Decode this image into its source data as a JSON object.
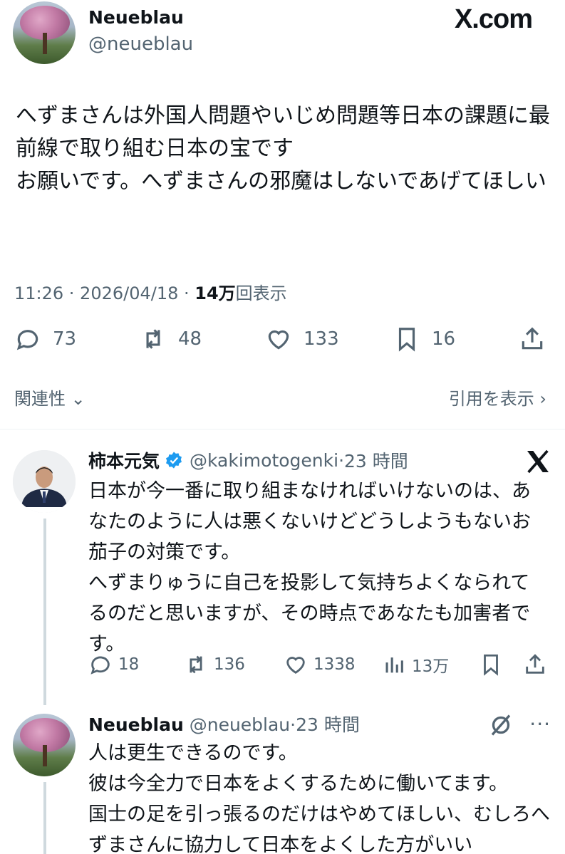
{
  "site_logo": "X.com",
  "main_post": {
    "author_name": "Neueblau",
    "author_handle": "@neueblau",
    "text": "へずまさんは外国人問題やいじめ問題等日本の課題に最前線で取り組む日本の宝です\nお願いです。へずまさんの邪魔はしないであげてほしい",
    "timestamp": "11:26 · 2026/04/18 · ",
    "views_count": "14万",
    "views_label": "回表示",
    "replies": "73",
    "reposts": "48",
    "likes": "133",
    "bookmarks": "16"
  },
  "related_label": "関連性",
  "quotes_label": "引用を表示",
  "reply_1": {
    "author_name": "柿本元気",
    "author_handle": "@kakimotogenki",
    "time": "23 時間",
    "text": "日本が今一番に取り組まなければいけないのは、あなたのように人は悪くないけどどうしようもないお茄子の対策です。\nへずまりゅうに自己を投影して気持ちよくなられてるのだと思いますが、その時点であなたも加害者です。",
    "replies": "18",
    "reposts": "136",
    "likes": "1338",
    "views": "13万"
  },
  "reply_2": {
    "author_name": "Neueblau",
    "author_handle": "@neueblau",
    "time": "23 時間",
    "text": "人は更生できるのです。\n彼は今全力で日本をよくするために働いてます。\n国士の足を引っ張るのだけはやめてほしい、むしろへずまさんに協力して日本をよくした方がいい"
  },
  "colors": {
    "text": "#0f1419",
    "secondary": "#536471",
    "verified": "#1d9bf0",
    "thread_line": "#cfd9de"
  },
  "icons": [
    "reply-icon",
    "repost-icon",
    "like-icon",
    "bookmark-icon",
    "share-icon",
    "views-icon",
    "verified-badge-icon",
    "x-logo-icon",
    "grok-icon",
    "more-icon",
    "chevron-down-icon",
    "chevron-right-icon"
  ]
}
